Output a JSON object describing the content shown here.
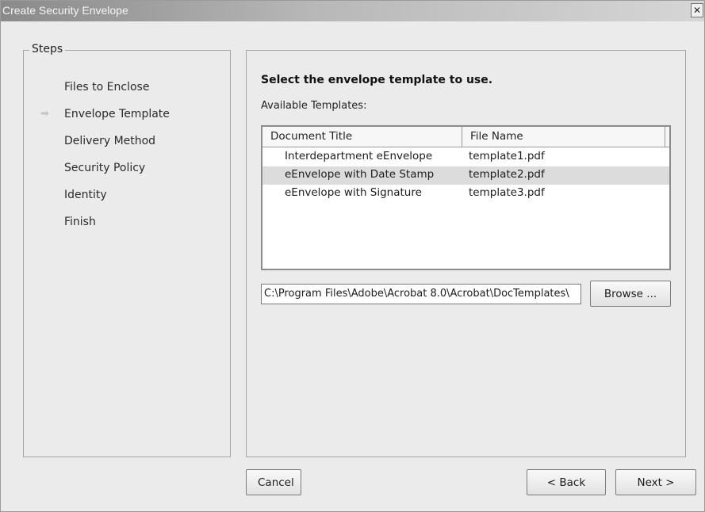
{
  "window": {
    "title": "Create Security Envelope"
  },
  "steps": {
    "legend": "Steps",
    "current_marker": "arrow-right-icon",
    "items": [
      {
        "label": "Files to Enclose",
        "current": false
      },
      {
        "label": "Envelope Template",
        "current": true
      },
      {
        "label": "Delivery Method",
        "current": false
      },
      {
        "label": "Security Policy",
        "current": false
      },
      {
        "label": "Identity",
        "current": false
      },
      {
        "label": "Finish",
        "current": false
      }
    ]
  },
  "main": {
    "heading": "Select the envelope template to use.",
    "available_label": "Available Templates:",
    "templates": {
      "columns": [
        "Document Title",
        "File Name"
      ],
      "rows": [
        {
          "title": "Interdepartment eEnvelope",
          "file": "template1.pdf",
          "selected": false
        },
        {
          "title": "eEnvelope with Date Stamp",
          "file": "template2.pdf",
          "selected": true
        },
        {
          "title": "eEnvelope with Signature",
          "file": "template3.pdf",
          "selected": false
        }
      ]
    },
    "path_value": "C:\\Program Files\\Adobe\\Acrobat 8.0\\Acrobat\\DocTemplates\\",
    "browse_label": "Browse ..."
  },
  "footer": {
    "cancel_label": "Cancel",
    "back_label": "< Back",
    "next_label": "Next >"
  },
  "colors": {
    "window_bg": "#ebebeb",
    "selected_row": "#dcdcdc",
    "title_text": "#f4f4f4"
  }
}
